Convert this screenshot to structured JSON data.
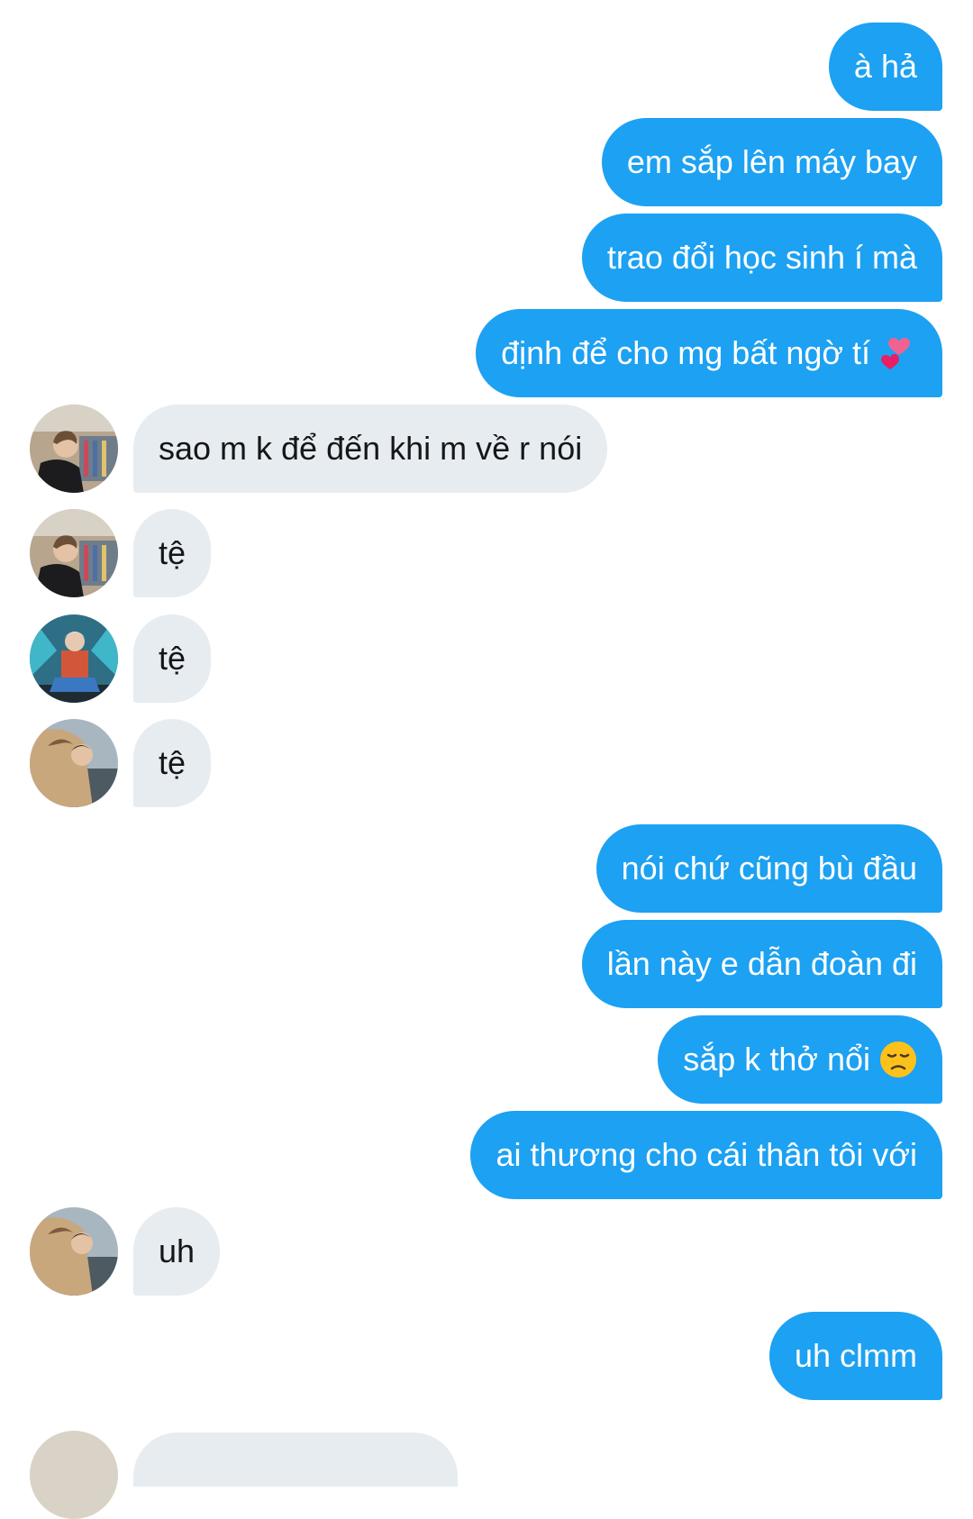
{
  "messages": [
    {
      "side": "out",
      "text": "à hả"
    },
    {
      "side": "out",
      "text": "em sắp lên máy bay"
    },
    {
      "side": "out",
      "text": "trao đổi học sinh í mà"
    },
    {
      "side": "out",
      "text": "định để cho mg bất ngờ tí",
      "emoji": "two-hearts-icon"
    },
    {
      "side": "in",
      "text": "sao m k để đến khi m về r nói",
      "avatar": "user-a"
    },
    {
      "side": "in",
      "text": "tệ",
      "avatar": "user-a"
    },
    {
      "side": "in",
      "text": "tệ",
      "avatar": "user-b"
    },
    {
      "side": "in",
      "text": "tệ",
      "avatar": "user-c"
    },
    {
      "side": "out",
      "text": "nói chứ cũng bù đầu"
    },
    {
      "side": "out",
      "text": "lần này e dẫn đoàn đi"
    },
    {
      "side": "out",
      "text": "sắp k thở nổi",
      "emoji": "disappointed-face-icon"
    },
    {
      "side": "out",
      "text": "ai thương cho cái thân tôi với"
    },
    {
      "side": "in",
      "text": "uh",
      "avatar": "user-c"
    },
    {
      "side": "out",
      "text": "uh clmm"
    }
  ],
  "colors": {
    "outgoing_bubble": "#1da1f2",
    "incoming_bubble": "#e7ecf0",
    "outgoing_text": "#ffffff",
    "incoming_text": "#14171a"
  }
}
